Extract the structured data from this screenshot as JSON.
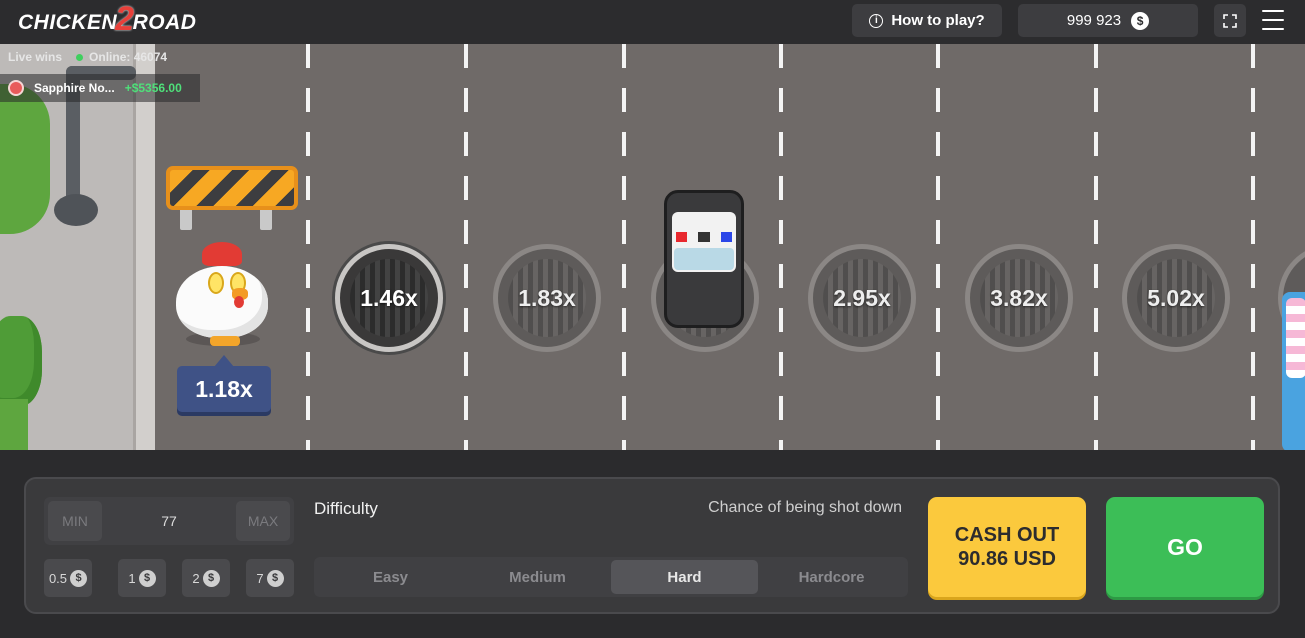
{
  "header": {
    "logo_left": "CHICKEN",
    "logo_num": "2",
    "logo_right": "ROAD",
    "how_to_play": "How to play?",
    "balance": "999 923",
    "currency_icon": "$"
  },
  "live": {
    "title": "Live wins",
    "online": "Online: 46074",
    "player": "Sapphire No...",
    "amount": "+$5356.00"
  },
  "game": {
    "current_multiplier": "1.18x",
    "multipliers": [
      "1.46x",
      "1.83x",
      "2.95x",
      "3.82x",
      "5.02x"
    ]
  },
  "bet": {
    "min_label": "MIN",
    "max_label": "MAX",
    "value": "77",
    "chips": [
      "0.5",
      "1",
      "2",
      "7"
    ]
  },
  "difficulty": {
    "label": "Difficulty",
    "chance_label": "Chance of being shot down",
    "options": [
      "Easy",
      "Medium",
      "Hard",
      "Hardcore"
    ],
    "selected": "Hard"
  },
  "actions": {
    "cashout_line1": "CASH OUT",
    "cashout_line2": "90.86 USD",
    "go": "GO"
  },
  "colors": {
    "road": "#6f6a68",
    "cashout": "#fbc93d",
    "go": "#3cbe57",
    "multiplier_badge": "#3f5286"
  }
}
